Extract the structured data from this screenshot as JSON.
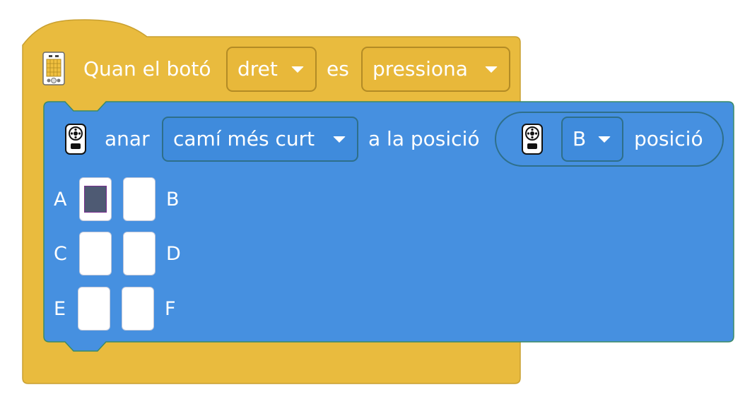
{
  "hat_block": {
    "label_start": "Quan el botó",
    "button_dropdown": "dret",
    "label_mid": "es",
    "state_dropdown": "pressiona",
    "icon": "controller-board-icon",
    "color": "#E9BB3E"
  },
  "move_block": {
    "label_start": "anar",
    "path_dropdown": "camí més curt",
    "label_mid": "a la posició",
    "icon": "robot-icon",
    "color": "#4690E0",
    "position_reporter": {
      "icon": "robot-icon",
      "dropdown": "B",
      "label": "posició"
    },
    "grid": {
      "labels": [
        "A",
        "B",
        "C",
        "D",
        "E",
        "F"
      ],
      "selected": "A"
    }
  }
}
